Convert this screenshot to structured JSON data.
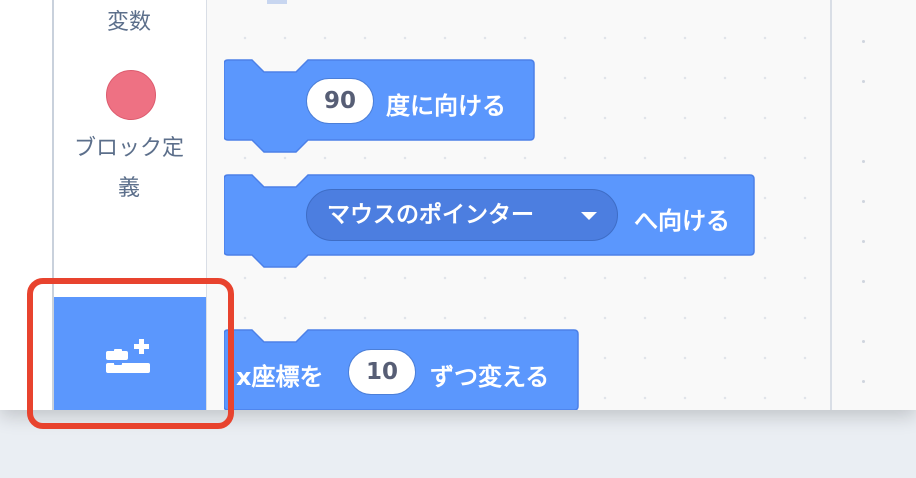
{
  "categories": {
    "variables_label": "変数",
    "my_blocks_label_line1": "ブロック定",
    "my_blocks_label_line2": "義",
    "my_blocks_color": "#ee7183"
  },
  "extension_button": {
    "icon": "add-extension-icon",
    "color": "#5b97fd",
    "highlight_color": "#e8432e"
  },
  "blocks": {
    "point_in_direction": {
      "value": "90",
      "suffix": "度に向ける"
    },
    "point_towards": {
      "dropdown_value": "マウスのポインター",
      "suffix": "へ向ける"
    },
    "change_x_by": {
      "prefix": "x座標を",
      "value": "10",
      "suffix": "ずつ変える"
    },
    "block_color": "#5b97fd"
  }
}
